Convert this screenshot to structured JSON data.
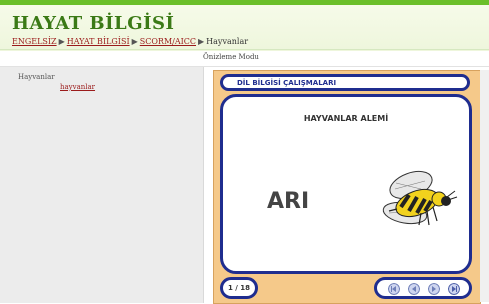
{
  "header": {
    "title": "HAYAT BİLGİSİ",
    "breadcrumbs": [
      "ENGELSİZ",
      "HAYAT BİLGİSİ",
      "SCORM/AICC"
    ],
    "current": "Hayvanlar"
  },
  "mode_label": "Önizleme Modu",
  "sidebar": {
    "root": "Hayvanlar",
    "link": "hayvanlar"
  },
  "player": {
    "section_title": "DİL BİLGİSİ ÇALIŞMALARI",
    "content_title": "HAYVANLAR ALEMİ",
    "word": "ARI",
    "page_indicator": "1 / 18"
  },
  "icons": {
    "breadcrumb_separator": "▶",
    "nav": [
      "first-page-icon",
      "previous-page-icon",
      "next-page-icon",
      "last-page-icon"
    ]
  }
}
